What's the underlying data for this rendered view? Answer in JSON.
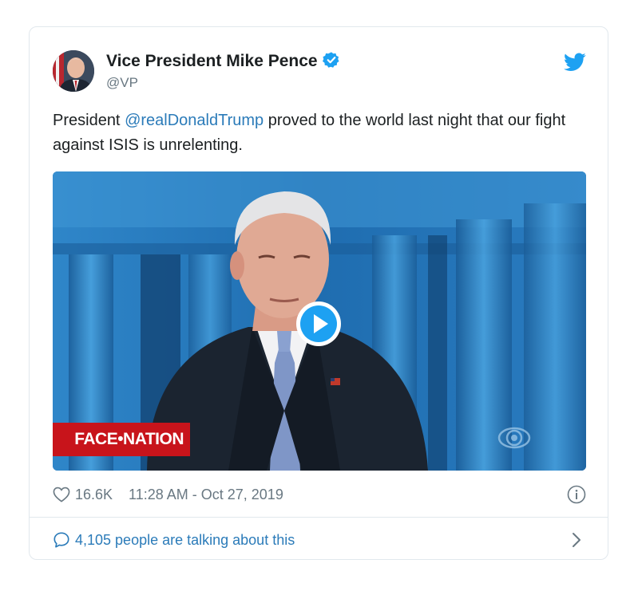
{
  "author": {
    "name": "Vice President Mike Pence",
    "handle": "@VP",
    "verified": true,
    "avatar_icon": "avatar-portrait"
  },
  "tweet": {
    "text_before": "President ",
    "mention": "@realDonaldTrump",
    "text_after": " proved to the world last night that our fight against ISIS is unrelenting."
  },
  "media": {
    "type": "video",
    "overlay_label": "FACE•NATION",
    "play_icon": "play-icon",
    "network_icon": "cbs-eye-icon"
  },
  "meta": {
    "likes": "16.6K",
    "timestamp": "11:28 AM - Oct 27, 2019"
  },
  "footer": {
    "talking_text": "4,105 people are talking about this"
  },
  "colors": {
    "link": "#2b7bb9",
    "muted": "#697882",
    "twitter_blue": "#1da1f2",
    "face_nation_red": "#c8141b"
  }
}
